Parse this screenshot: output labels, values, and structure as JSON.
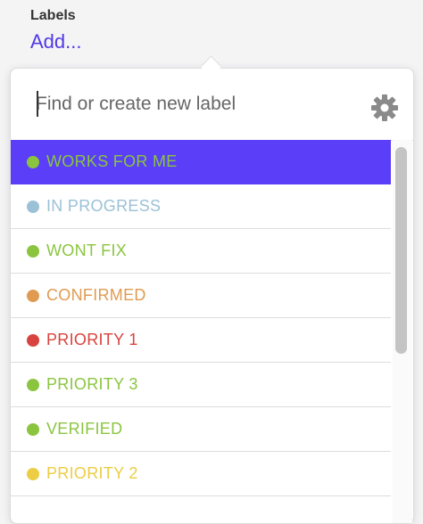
{
  "section": {
    "title": "Labels",
    "add_link": "Add..."
  },
  "search": {
    "placeholder": "Find or create new label",
    "value": ""
  },
  "settings_icon": "gear-icon",
  "colors": {
    "accent": "#4f39e6",
    "selected_bg": "#5a3ef8",
    "green": "#8bc53f",
    "light_blue": "#9cc1d6",
    "orange": "#e09b51",
    "red": "#d9433f",
    "yellow": "#eccd43"
  },
  "labels": [
    {
      "name": "WORKS FOR ME",
      "color": "#8bc53f",
      "selected": true
    },
    {
      "name": "IN PROGRESS",
      "color": "#9cc1d6",
      "selected": false
    },
    {
      "name": "WONT FIX",
      "color": "#8bc53f",
      "selected": false
    },
    {
      "name": "CONFIRMED",
      "color": "#e09b51",
      "selected": false
    },
    {
      "name": "PRIORITY 1",
      "color": "#d9433f",
      "selected": false
    },
    {
      "name": "PRIORITY 3",
      "color": "#8bc53f",
      "selected": false
    },
    {
      "name": "VERIFIED",
      "color": "#8bc53f",
      "selected": false
    },
    {
      "name": "PRIORITY 2",
      "color": "#eccd43",
      "selected": false
    }
  ]
}
